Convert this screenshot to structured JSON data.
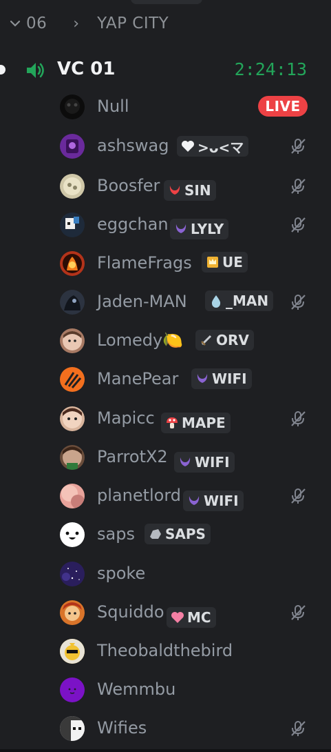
{
  "top_pill": {},
  "category": {
    "number": "06",
    "separator": "›",
    "name": "YAP CITY"
  },
  "voice_channel": {
    "name": "VC 01",
    "timer": "2:24:13",
    "live_badge": "LIVE"
  },
  "users": [
    {
      "name": "Null",
      "tag": null,
      "muted": false,
      "live": true,
      "avatar_color": "#0c0c0c"
    },
    {
      "name": "ashswag",
      "tag": ">ᴗ<マ",
      "tag_icon": "heart-icon",
      "muted": true,
      "avatar_color": "#6a2a9c"
    },
    {
      "name": "Boosfer",
      "tag": "SIN",
      "tag_icon": "red-horns-icon",
      "muted": true,
      "avatar_color": "#cfc7a8"
    },
    {
      "name": "eggchan",
      "tag": "LYLY",
      "tag_icon": "purple-horns-icon",
      "muted": true,
      "avatar_color": "#1e2a3a"
    },
    {
      "name": "FlameFrags",
      "tag": "UE",
      "tag_icon": "crown-icon",
      "muted": false,
      "avatar_color": "#b3331a"
    },
    {
      "name": "Jaden-MAN",
      "tag": "_MAN",
      "tag_icon": "droplet-icon",
      "muted": true,
      "avatar_color": "#2c3340"
    },
    {
      "name": "Lomedy🍋",
      "tag": "ORV",
      "tag_icon": "sword-icon",
      "muted": false,
      "avatar_color": "#a87a64"
    },
    {
      "name": "ManePear",
      "tag": "WIFI",
      "tag_icon": "purple-horns-icon",
      "muted": false,
      "avatar_color": "#f26f1e"
    },
    {
      "name": "Mapicc",
      "tag": "MAPE",
      "tag_icon": "mushroom-icon",
      "muted": true,
      "avatar_color": "#d8b49c"
    },
    {
      "name": "ParrotX2",
      "tag": "WIFI",
      "tag_icon": "purple-horns-icon",
      "muted": false,
      "avatar_color": "#6a4d3b"
    },
    {
      "name": "planetlord",
      "tag": "WIFI",
      "tag_icon": "purple-horns-icon",
      "muted": true,
      "avatar_color": "#e8a39b"
    },
    {
      "name": "saps",
      "tag": "SAPS",
      "tag_icon": "rock-icon",
      "muted": false,
      "avatar_color": "#ffffff"
    },
    {
      "name": "spoke",
      "tag": null,
      "muted": false,
      "avatar_color": "#2a1e5c"
    },
    {
      "name": "Squiddo",
      "tag": "MC",
      "tag_icon": "pink-heart-icon",
      "muted": true,
      "avatar_color": "#d9742a"
    },
    {
      "name": "Theobaldthebird",
      "tag": null,
      "muted": false,
      "avatar_color": "#f1c232"
    },
    {
      "name": "Wemmbu",
      "tag": null,
      "muted": false,
      "avatar_color": "#7b12c6"
    },
    {
      "name": "Wifies",
      "tag": null,
      "muted": true,
      "avatar_color": "#d8d8d8"
    }
  ],
  "colors": {
    "background": "#1e1f22",
    "accent_green": "#23a55a",
    "live_red": "#ed4245",
    "tag_bg": "#2b2d31"
  }
}
